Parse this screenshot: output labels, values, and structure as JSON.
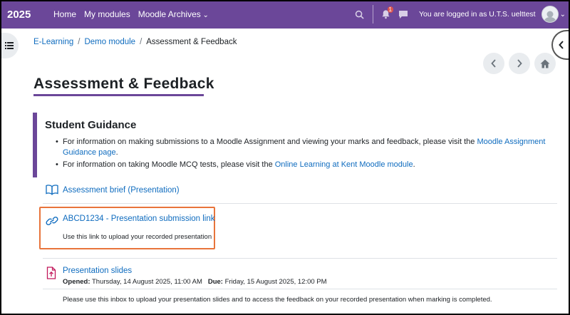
{
  "navbar": {
    "brand": "2025",
    "links": [
      "Home",
      "My modules",
      "Moodle Archives"
    ],
    "notification_count": "1",
    "login_text": "You are logged in as U.T.S. uelttest",
    "icons": [
      "search-icon",
      "bell-icon",
      "chat-icon",
      "avatar"
    ],
    "bg_color": "#6b4799"
  },
  "breadcrumb": {
    "items": [
      "E-Learning",
      "Demo module"
    ],
    "current": "Assessment & Feedback",
    "separator": "/"
  },
  "page": {
    "title": "Assessment & Feedback",
    "accent_color": "#6b4799"
  },
  "guidance": {
    "heading": "Student Guidance",
    "item1_text": "For information on making submissions to a Moodle Assignment and viewing your marks and feedback, please visit the ",
    "item1_link": "Moodle Assignment Guidance page",
    "item1_end": ".",
    "item2_text": "For information on taking Moodle MCQ tests, please visit the ",
    "item2_link": "Online Learning at Kent Moodle module",
    "item2_end": "."
  },
  "activities": [
    {
      "title": "Assessment brief (Presentation)",
      "icon": "book-icon"
    },
    {
      "title": "ABCD1234 - Presentation submission link",
      "icon": "link-icon",
      "description": "Use this link to upload your recorded presentation",
      "highlight_color": "#e8743b"
    },
    {
      "title": "Presentation slides",
      "icon": "upload-file-icon",
      "opened_label": "Opened:",
      "opened_value": "Thursday, 14 August 2025, 11:00 AM",
      "due_label": "Due:",
      "due_value": "Friday, 15 August 2025, 12:00 PM",
      "description": "Please use this inbox to upload your presentation slides and to access the feedback on your recorded presentation when marking is completed."
    }
  ]
}
